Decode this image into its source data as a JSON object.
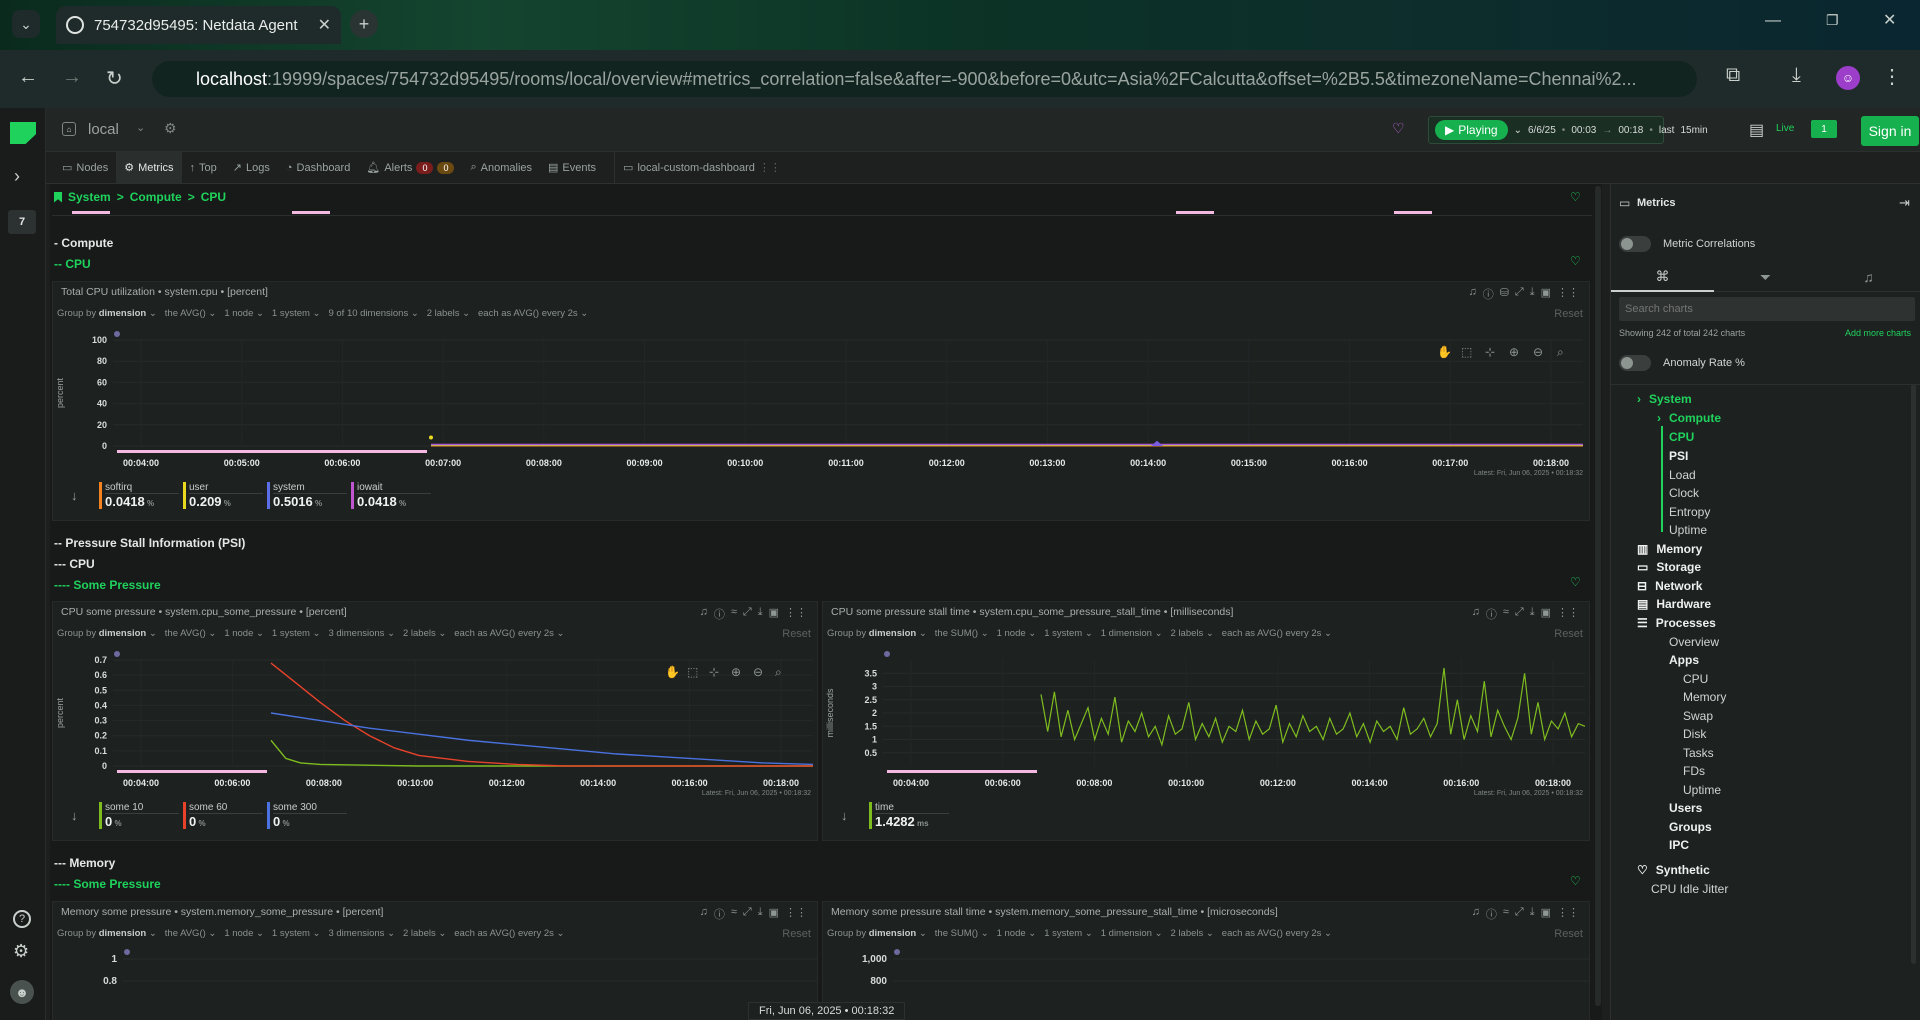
{
  "browser": {
    "tab_title": "754732d95495: Netdata Agent",
    "url_host": "localhost",
    "url_rest": ":19999/spaces/754732d95495/rooms/local/overview#metrics_correlation=false&after=-900&before=0&utc=Asia%2FCalcutta&offset=%2B5.5&timezoneName=Chennai%2..."
  },
  "topbar": {
    "room": "local",
    "playing": "Playing",
    "date": "6/6/25",
    "from": "00:03",
    "to": "00:18",
    "last_label": "last",
    "window": "15min",
    "live": "Live",
    "live_count": "1",
    "sign_in": "Sign in"
  },
  "rail": {
    "badge": "7"
  },
  "tabs": [
    "Nodes",
    "Metrics",
    "Top",
    "Logs",
    "Dashboard",
    "Alerts",
    "Anomalies",
    "Events",
    "local-custom-dashboard"
  ],
  "alerts": {
    "crit": "0",
    "warn": "0"
  },
  "breadcrumb": {
    "a": "System",
    "b": "Compute",
    "c": "CPU",
    "sep": ">"
  },
  "sections": {
    "compute": "- Compute",
    "cpu": "-- CPU",
    "psi": "-- Pressure Stall Information (PSI)",
    "psi_cpu": "--- CPU",
    "some_pressure": "---- Some Pressure",
    "memory": "--- Memory",
    "some_pressure2": "---- Some Pressure"
  },
  "panels": {
    "cpu": {
      "title": "Total CPU utilization • system.cpu • [percent]",
      "bar": [
        "Group by",
        "dimension",
        "the AVG()",
        "1 node",
        "1 system",
        "9 of 10 dimensions",
        "2 labels",
        "each as AVG() every 2s"
      ],
      "reset": "Reset",
      "ylabel": "percent",
      "latest": "Latest: Fri, Jun 06, 2025 • 00:18:32",
      "legend": [
        {
          "name": "softirq",
          "value": "0.0418",
          "unit": "%",
          "color": "#f58220"
        },
        {
          "name": "user",
          "value": "0.209",
          "unit": "%",
          "color": "#e8d91e"
        },
        {
          "name": "system",
          "value": "0.5016",
          "unit": "%",
          "color": "#5b6ee8"
        },
        {
          "name": "iowait",
          "value": "0.0418",
          "unit": "%",
          "color": "#c055d0"
        }
      ]
    },
    "cpu_some": {
      "title": "CPU some pressure • system.cpu_some_pressure • [percent]",
      "bar": [
        "Group by",
        "dimension",
        "the AVG()",
        "1 node",
        "1 system",
        "3 dimensions",
        "2 labels",
        "each as AVG() every 2s"
      ],
      "reset": "Reset",
      "ylabel": "percent",
      "latest": "Latest: Fri, Jun 06, 2025 • 00:18:32",
      "legend": [
        {
          "name": "some 10",
          "value": "0",
          "unit": "%",
          "color": "#7fbd1f"
        },
        {
          "name": "some 60",
          "value": "0",
          "unit": "%",
          "color": "#e8432a"
        },
        {
          "name": "some 300",
          "value": "0",
          "unit": "%",
          "color": "#4a72e0"
        }
      ]
    },
    "cpu_stall": {
      "title": "CPU some pressure stall time • system.cpu_some_pressure_stall_time • [milliseconds]",
      "bar": [
        "Group by",
        "dimension",
        "the SUM()",
        "1 node",
        "1 system",
        "1 dimension",
        "2 labels",
        "each as AVG() every 2s"
      ],
      "reset": "Reset",
      "ylabel": "milliseconds",
      "latest": "Latest: Fri, Jun 06, 2025 • 00:18:32",
      "legend": [
        {
          "name": "time",
          "value": "1.4282",
          "unit": "ms",
          "color": "#7fbd1f"
        }
      ]
    },
    "mem_some": {
      "title": "Memory some pressure • system.memory_some_pressure • [percent]",
      "bar": [
        "Group by",
        "dimension",
        "the AVG()",
        "1 node",
        "1 system",
        "3 dimensions",
        "2 labels",
        "each as AVG() every 2s"
      ],
      "reset": "Reset"
    },
    "mem_stall": {
      "title": "Memory some pressure stall time • system.memory_some_pressure_stall_time • [microseconds]",
      "bar": [
        "Group by",
        "dimension",
        "the SUM()",
        "1 node",
        "1 system",
        "1 dimension",
        "2 labels",
        "each as AVG() every 2s"
      ],
      "reset": "Reset"
    }
  },
  "footer_time": "Fri, Jun 06, 2025 • 00:18:32",
  "sidebar": {
    "title": "Metrics",
    "metric_correlations": "Metric Correlations",
    "search_placeholder": "Search charts",
    "showing": "Showing 242 of total 242 charts",
    "add_more": "Add more charts",
    "anomaly_rate": "Anomaly Rate %",
    "tree": [
      {
        "label": "System",
        "style": "g"
      },
      {
        "label": "Compute",
        "style": "g"
      },
      {
        "label": "CPU",
        "style": "g"
      },
      {
        "label": "PSI",
        "style": "b"
      },
      {
        "label": "Load",
        "style": ""
      },
      {
        "label": "Clock",
        "style": ""
      },
      {
        "label": "Entropy",
        "style": ""
      },
      {
        "label": "Uptime",
        "style": ""
      },
      {
        "label": "Memory",
        "style": "b"
      },
      {
        "label": "Storage",
        "style": "b"
      },
      {
        "label": "Network",
        "style": "b"
      },
      {
        "label": "Hardware",
        "style": "b"
      },
      {
        "label": "Processes",
        "style": "b"
      },
      {
        "label": "Overview",
        "style": ""
      },
      {
        "label": "Apps",
        "style": "b"
      },
      {
        "label": "CPU",
        "style": ""
      },
      {
        "label": "Memory",
        "style": ""
      },
      {
        "label": "Swap",
        "style": ""
      },
      {
        "label": "Disk",
        "style": ""
      },
      {
        "label": "Tasks",
        "style": ""
      },
      {
        "label": "FDs",
        "style": ""
      },
      {
        "label": "Uptime",
        "style": ""
      },
      {
        "label": "Users",
        "style": "b"
      },
      {
        "label": "Groups",
        "style": "b"
      },
      {
        "label": "IPC",
        "style": "b"
      },
      {
        "label": "Synthetic",
        "style": "b"
      },
      {
        "label": "CPU Idle Jitter",
        "style": ""
      }
    ]
  },
  "chart_data": [
    {
      "type": "area",
      "title": "Total CPU utilization",
      "ylabel": "percent",
      "ylim": [
        0,
        100
      ],
      "yticks": [
        0,
        20,
        40,
        60,
        80,
        100
      ],
      "x": [
        "00:04:00",
        "00:05:00",
        "00:06:00",
        "00:07:00",
        "00:08:00",
        "00:09:00",
        "00:10:00",
        "00:11:00",
        "00:12:00",
        "00:13:00",
        "00:14:00",
        "00:15:00",
        "00:16:00",
        "00:17:00",
        "00:18:00"
      ],
      "series": [
        {
          "name": "softirq",
          "values": [
            0.04
          ]
        },
        {
          "name": "user",
          "values": [
            0.21
          ]
        },
        {
          "name": "system",
          "values": [
            0.5
          ]
        },
        {
          "name": "iowait",
          "values": [
            0.04
          ]
        }
      ]
    },
    {
      "type": "line",
      "title": "CPU some pressure",
      "ylabel": "percent",
      "ylim": [
        0,
        0.7
      ],
      "yticks": [
        0,
        0.1,
        0.2,
        0.3,
        0.4,
        0.5,
        0.6,
        0.7
      ],
      "x": [
        "00:04:00",
        "00:06:00",
        "00:08:00",
        "00:10:00",
        "00:12:00",
        "00:14:00",
        "00:16:00",
        "00:18:00"
      ],
      "series": [
        {
          "name": "some 10",
          "points": [
            [
              0,
              0.17
            ],
            [
              0.3,
              0.05
            ],
            [
              0.6,
              0.02
            ],
            [
              1,
              0.01
            ],
            [
              3,
              0.0
            ],
            [
              11,
              0.0
            ]
          ]
        },
        {
          "name": "some 60",
          "points": [
            [
              0,
              0.68
            ],
            [
              0.5,
              0.55
            ],
            [
              1,
              0.42
            ],
            [
              1.5,
              0.3
            ],
            [
              2,
              0.2
            ],
            [
              2.5,
              0.12
            ],
            [
              3,
              0.07
            ],
            [
              4,
              0.03
            ],
            [
              5,
              0.01
            ],
            [
              6,
              0.0
            ],
            [
              11,
              0.0
            ]
          ]
        },
        {
          "name": "some 300",
          "points": [
            [
              0,
              0.35
            ],
            [
              1,
              0.3
            ],
            [
              2,
              0.25
            ],
            [
              3,
              0.21
            ],
            [
              4,
              0.17
            ],
            [
              5,
              0.14
            ],
            [
              6,
              0.11
            ],
            [
              7,
              0.08
            ],
            [
              8,
              0.06
            ],
            [
              9,
              0.04
            ],
            [
              10,
              0.02
            ],
            [
              11,
              0.01
            ]
          ]
        }
      ]
    },
    {
      "type": "line",
      "title": "CPU some pressure stall time",
      "ylabel": "milliseconds",
      "ylim": [
        0,
        4
      ],
      "yticks": [
        0.5,
        1,
        1.5,
        2,
        2.5,
        3,
        3.5
      ],
      "x": [
        "00:04:00",
        "00:06:00",
        "00:08:00",
        "00:10:00",
        "00:12:00",
        "00:14:00",
        "00:16:00",
        "00:18:00"
      ],
      "series": [
        {
          "name": "time",
          "values": [
            2.7,
            1.3,
            2.8,
            1.1,
            2.1,
            1.0,
            1.6,
            2.2,
            1.0,
            1.8,
            1.2,
            2.6,
            0.9,
            1.7,
            1.3,
            2.0,
            1.1,
            1.5,
            0.8,
            1.9,
            1.2,
            1.4,
            2.4,
            1.0,
            1.6,
            1.1,
            1.8,
            0.9,
            1.5,
            1.3,
            2.1,
            1.0,
            1.7,
            1.2,
            1.4,
            2.3,
            0.9,
            1.6,
            1.1,
            1.9,
            1.3,
            1.5,
            1.0,
            1.8,
            1.2,
            1.4,
            2.0,
            1.1,
            1.6,
            0.9,
            1.7,
            1.3,
            1.5,
            1.0,
            2.2,
            1.2,
            1.4,
            1.8,
            1.1,
            1.6,
            3.7,
            1.2,
            2.5,
            1.0,
            1.9,
            1.3,
            3.2,
            1.1,
            2.1,
            1.5,
            1.0,
            1.8,
            3.5,
            1.2,
            2.4,
            1.0,
            1.7,
            1.4,
            2.0,
            1.1,
            1.6,
            1.5
          ]
        }
      ]
    }
  ]
}
